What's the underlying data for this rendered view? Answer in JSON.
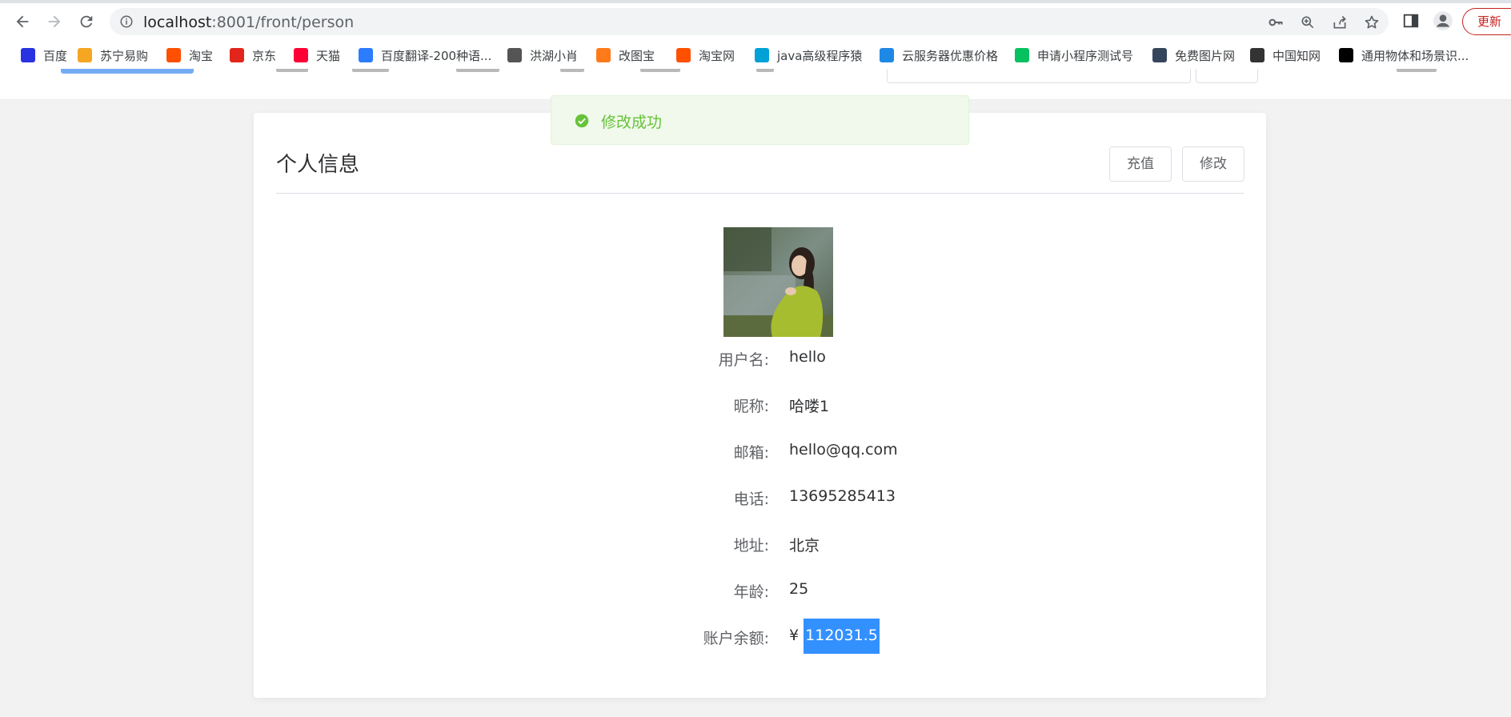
{
  "browser": {
    "url_host": "localhost",
    "url_path": ":8001/front/person",
    "update_label": "更新"
  },
  "bookmarks": [
    {
      "label": "百度",
      "color": "#2932e1"
    },
    {
      "label": "苏宁易购",
      "color": "#f5a623"
    },
    {
      "label": "淘宝",
      "color": "#ff5000"
    },
    {
      "label": "京东",
      "color": "#e1251b"
    },
    {
      "label": "天猫",
      "color": "#ff0036"
    },
    {
      "label": "百度翻译-200种语...",
      "color": "#2b7cff"
    },
    {
      "label": "洪湖小肖",
      "color": "#555555"
    },
    {
      "label": "改图宝",
      "color": "#ff7a1a"
    },
    {
      "label": "淘宝网",
      "color": "#ff5000"
    },
    {
      "label": "java高级程序猿",
      "color": "#00a1d6"
    },
    {
      "label": "云服务器优惠价格",
      "color": "#1e88e5"
    },
    {
      "label": "申请小程序测试号",
      "color": "#07c160"
    },
    {
      "label": "免费图片网",
      "color": "#35465c"
    },
    {
      "label": "中国知网",
      "color": "#333333"
    },
    {
      "label": "通用物体和场景识...",
      "color": "#000000"
    }
  ],
  "toast": {
    "message": "修改成功"
  },
  "card": {
    "title": "个人信息",
    "recharge_label": "充值",
    "edit_label": "修改"
  },
  "profile": {
    "username_label": "用户名:",
    "username": "hello",
    "nickname_label": "昵称:",
    "nickname": "哈喽1",
    "email_label": "邮箱:",
    "email": "hello@qq.com",
    "phone_label": "电话:",
    "phone": "13695285413",
    "address_label": "地址:",
    "address": "北京",
    "age_label": "年龄:",
    "age": "25",
    "balance_label": "账户余额:",
    "currency": "¥",
    "balance": "112031.5"
  }
}
